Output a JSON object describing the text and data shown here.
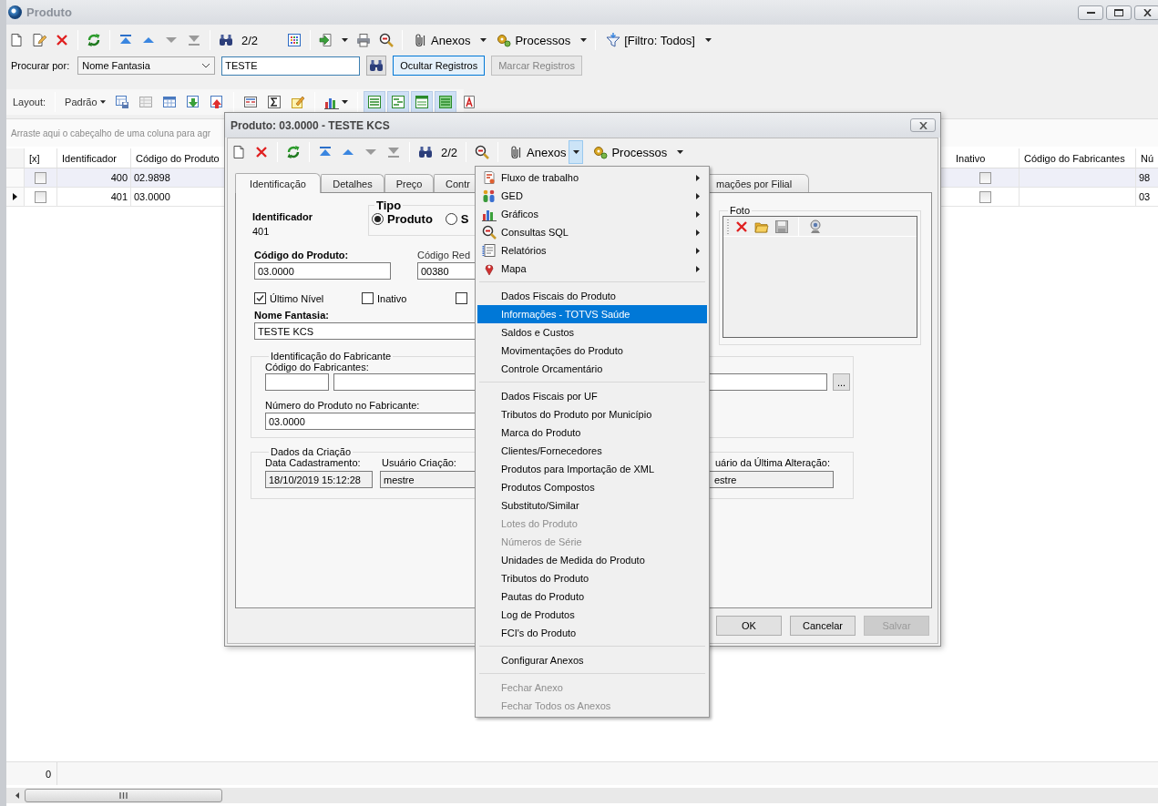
{
  "main_window": {
    "title": "Produto"
  },
  "toolbar": {
    "record_counter": "2/2",
    "attachments": "Anexos",
    "processes": "Processos",
    "filter": "[Filtro: Todos]"
  },
  "search": {
    "label": "Procurar por:",
    "search_by": "Nome Fantasia",
    "value": "TESTE",
    "buttons": [
      {
        "label": "Ocultar Registros",
        "highlighted": true,
        "disabled": false
      },
      {
        "label": "Marcar Registros",
        "highlighted": false,
        "disabled": true
      }
    ]
  },
  "layout_bar": {
    "label": "Layout:",
    "preset": "Padrão"
  },
  "grid": {
    "group_hint": "Arraste aqui o cabeçalho de uma coluna para agr",
    "columns": [
      "[x]",
      "Identificador",
      "Código do Produto",
      "Inativo",
      "Código do Fabricantes",
      "Nú"
    ],
    "rows": [
      {
        "current": false,
        "marked": false,
        "identificador": "400",
        "codigo": "02.9898",
        "inativo": false,
        "column_6": "98"
      },
      {
        "current": true,
        "marked": false,
        "identificador": "401",
        "codigo": "03.0000",
        "inativo": false,
        "column_6": "03"
      }
    ],
    "footer_count": "0"
  },
  "dialog": {
    "title": "Produto: 03.0000 - TESTE KCS",
    "record_counter": "2/2",
    "attachments": "Anexos",
    "attachments_open": true,
    "processes": "Processos",
    "tabs": [
      {
        "label": "Identificação",
        "selected": true
      },
      {
        "label": "Detalhes",
        "selected": false
      },
      {
        "label": "Preço",
        "selected": false
      },
      {
        "label": "Contr",
        "selected": false
      },
      {
        "label": "mações por Filial",
        "selected": false
      }
    ],
    "identificador": {
      "label": "Identificador",
      "value": "401"
    },
    "tipo": {
      "label": "Tipo",
      "options": [
        {
          "label": "Produto",
          "selected": true
        },
        {
          "label": "S",
          "selected": false
        }
      ]
    },
    "codigo_produto": {
      "label": "Código do Produto:",
      "value": "03.0000"
    },
    "codigo_red": {
      "label": "Código Red",
      "value": "00380"
    },
    "checkboxes": [
      {
        "label": "Último Nível",
        "checked": true
      },
      {
        "label": "Inativo",
        "checked": false
      },
      {
        "checked": false
      }
    ],
    "nome_fantasia": {
      "label": "Nome Fantasia:",
      "value": "TESTE KCS"
    },
    "fabricante": {
      "title": "Identificação do Fabricante",
      "codigo_label": "Código do Fabricantes:",
      "browse": "...",
      "numero_label": "Número do Produto no Fabricante:",
      "numero_value": "03.0000"
    },
    "criacao": {
      "title": "Dados da Criação",
      "data_label": "Data Cadastramento:",
      "data_value": "18/10/2019 15:12:28",
      "usuario_label": "Usuário Criação:",
      "usuario_value": "mestre",
      "alteracao_label": "uário da Última Alteração:",
      "alteracao_value": "estre"
    },
    "foto": {
      "title": "Foto"
    },
    "buttons": [
      {
        "label": "OK",
        "disabled": false
      },
      {
        "label": "Cancelar",
        "disabled": false
      },
      {
        "label": "Salvar",
        "disabled": true
      }
    ]
  },
  "menu": {
    "sections": [
      [
        {
          "label": "Fluxo de trabalho",
          "submenu": true,
          "disabled": false,
          "selected": false
        },
        {
          "label": "GED",
          "submenu": true,
          "disabled": false,
          "selected": false
        },
        {
          "label": "Gráficos",
          "submenu": true,
          "disabled": false,
          "selected": false
        },
        {
          "label": "Consultas SQL",
          "submenu": true,
          "disabled": false,
          "selected": false
        },
        {
          "label": "Relatórios",
          "submenu": true,
          "disabled": false,
          "selected": false
        },
        {
          "label": "Mapa",
          "submenu": true,
          "disabled": false,
          "selected": false
        }
      ],
      [
        {
          "label": "Dados Fiscais do Produto",
          "submenu": false,
          "disabled": false,
          "selected": false
        },
        {
          "label": "Informações - TOTVS Saúde",
          "submenu": false,
          "disabled": false,
          "selected": true
        },
        {
          "label": "Saldos e Custos",
          "submenu": false,
          "disabled": false,
          "selected": false
        },
        {
          "label": "Movimentações do Produto",
          "submenu": false,
          "disabled": false,
          "selected": false
        },
        {
          "label": "Controle Orcamentário",
          "submenu": false,
          "disabled": false,
          "selected": false
        }
      ],
      [
        {
          "label": "Dados Fiscais por UF",
          "submenu": false,
          "disabled": false,
          "selected": false
        },
        {
          "label": "Tributos do Produto por Município",
          "submenu": false,
          "disabled": false,
          "selected": false
        },
        {
          "label": "Marca do Produto",
          "submenu": false,
          "disabled": false,
          "selected": false
        },
        {
          "label": "Clientes/Fornecedores",
          "submenu": false,
          "disabled": false,
          "selected": false
        },
        {
          "label": "Produtos para Importação de XML",
          "submenu": false,
          "disabled": false,
          "selected": false
        },
        {
          "label": "Produtos Compostos",
          "submenu": false,
          "disabled": false,
          "selected": false
        },
        {
          "label": "Substituto/Similar",
          "submenu": false,
          "disabled": false,
          "selected": false
        },
        {
          "label": "Lotes do Produto",
          "submenu": false,
          "disabled": true,
          "selected": false
        },
        {
          "label": "Números de Série",
          "submenu": false,
          "disabled": true,
          "selected": false
        },
        {
          "label": "Unidades de Medida do Produto",
          "submenu": false,
          "disabled": false,
          "selected": false
        },
        {
          "label": "Tributos do Produto",
          "submenu": false,
          "disabled": false,
          "selected": false
        },
        {
          "label": "Pautas do Produto",
          "submenu": false,
          "disabled": false,
          "selected": false
        },
        {
          "label": "Log de Produtos",
          "submenu": false,
          "disabled": false,
          "selected": false
        },
        {
          "label": "FCI's do Produto",
          "submenu": false,
          "disabled": false,
          "selected": false
        }
      ],
      [
        {
          "label": "Configurar Anexos",
          "submenu": false,
          "disabled": false,
          "selected": false
        }
      ],
      [
        {
          "label": "Fechar Anexo",
          "submenu": false,
          "disabled": true,
          "selected": false
        },
        {
          "label": "Fechar Todos os Anexos",
          "submenu": false,
          "disabled": true,
          "selected": false
        }
      ]
    ]
  }
}
